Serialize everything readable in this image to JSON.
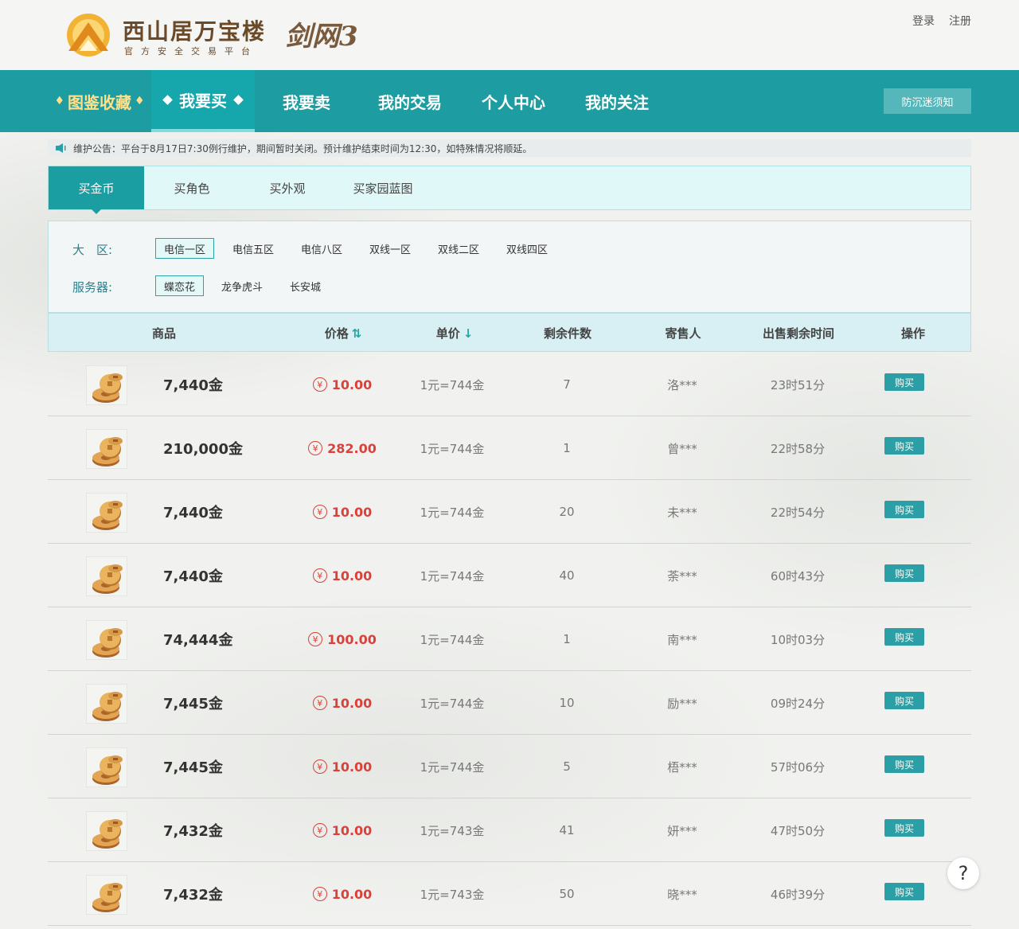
{
  "brand": {
    "title": "西山居万宝楼",
    "subtitle": "官方安全交易平台",
    "game_logo": "剑网3"
  },
  "auth": {
    "login": "登录",
    "register": "注册"
  },
  "nav": {
    "items": [
      {
        "label": "图鉴收藏"
      },
      {
        "label": "我要买"
      },
      {
        "label": "我要卖"
      },
      {
        "label": "我的交易"
      },
      {
        "label": "个人中心"
      },
      {
        "label": "我的关注"
      }
    ],
    "anti_addiction": "防沉迷须知"
  },
  "notice": "维护公告：平台于8月17日7:30例行维护，期间暂时关闭。预计维护结束时间为12:30，如特殊情况将顺延。",
  "sub_tabs": [
    "买金币",
    "买角色",
    "买外观",
    "买家园蓝图"
  ],
  "filters": {
    "region_label": "大　区:",
    "regions": [
      "电信一区",
      "电信五区",
      "电信八区",
      "双线一区",
      "双线二区",
      "双线四区"
    ],
    "region_selected": "电信一区",
    "server_label": "服务器:",
    "servers": [
      "蝶恋花",
      "龙争虎斗",
      "长安城"
    ],
    "server_selected": "蝶恋花"
  },
  "table": {
    "headers": {
      "product": "商品",
      "price": "价格",
      "unit_price": "单价",
      "stock": "剩余件数",
      "seller": "寄售人",
      "time_left": "出售剩余时间",
      "action": "操作"
    },
    "buy_label": "购买",
    "currency_symbol": "¥",
    "rows": [
      {
        "product": "7,440金",
        "price": "10.00",
        "unit": "1元=744金",
        "stock": "7",
        "seller": "洛***",
        "time": "23时51分"
      },
      {
        "product": "210,000金",
        "price": "282.00",
        "unit": "1元=744金",
        "stock": "1",
        "seller": "曾***",
        "time": "22时58分"
      },
      {
        "product": "7,440金",
        "price": "10.00",
        "unit": "1元=744金",
        "stock": "20",
        "seller": "未***",
        "time": "22时54分"
      },
      {
        "product": "7,440金",
        "price": "10.00",
        "unit": "1元=744金",
        "stock": "40",
        "seller": "荼***",
        "time": "60时43分"
      },
      {
        "product": "74,444金",
        "price": "100.00",
        "unit": "1元=744金",
        "stock": "1",
        "seller": "南***",
        "time": "10时03分"
      },
      {
        "product": "7,445金",
        "price": "10.00",
        "unit": "1元=744金",
        "stock": "10",
        "seller": "励***",
        "time": "09时24分"
      },
      {
        "product": "7,445金",
        "price": "10.00",
        "unit": "1元=744金",
        "stock": "5",
        "seller": "梧***",
        "time": "57时06分"
      },
      {
        "product": "7,432金",
        "price": "10.00",
        "unit": "1元=743金",
        "stock": "41",
        "seller": "妍***",
        "time": "47时50分"
      },
      {
        "product": "7,432金",
        "price": "10.00",
        "unit": "1元=743金",
        "stock": "50",
        "seller": "晓***",
        "time": "46时39分"
      }
    ]
  },
  "help": "?"
}
